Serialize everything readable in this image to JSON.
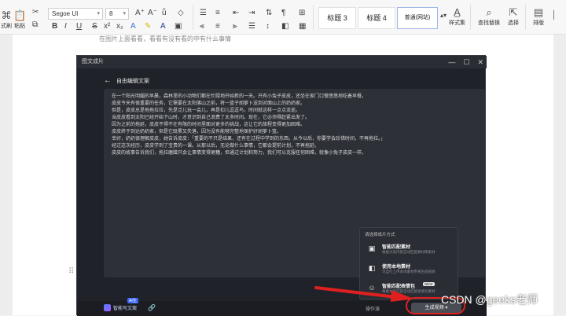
{
  "ribbon": {
    "format_label": "式刷",
    "paste_label": "粘贴",
    "font": "Segoe UI",
    "font_size": "8",
    "styles": [
      "标题 3",
      "标题 4",
      "普通(网站)"
    ],
    "style_set_label": "样式集",
    "find_replace_label": "查找替换",
    "select_label": "选择",
    "sort_label": "排版"
  },
  "document": {
    "cut_off_text": "在图片上面看看，看看有没有看的中有什么事情"
  },
  "dialog": {
    "title": "图文成片",
    "back_label": "自由编辑文案",
    "editor_lines": [
      "在一个阳光明媚的早晨，森林里的小动物们都在忙碌地开始新的一天。只有小兔子皮皮，还坐在家门口慢悠悠地吃着早餐。",
      "皮皮今天有很重要的任务，它需要在太阳落山之前，将一篮子胡萝卜送到对面山上的奶奶家。",
      "但是，皮皮总是拖拖拉拉，先是泛儿玩一会儿，再是扣儿逗逗鸟，时间就这样一点点流逝。",
      "当皮皮看到太阳已经开始下山时，才意识到自己浪费了太多时间。现在，它必须得赶紧出发了。",
      "因为之前的拖延，皮皮不得不在有限的时间里面对更多的挑战，这让它的旅程变得更加困难。",
      "皮皮终于到达奶奶家，但是它既累又失落，因为没有能够完整地保护好胡萝卜篮。",
      "幸好，奶奶很理解皮皮，她告诉皮皮：「重要的不只是结果，还有在过程中学到的东西。从今以后，你要学会珍惜时间，不再拖拉。」",
      "经过这次经历，皮皮学到了宝贵的一课。从那以后，无论做什么事情，它都会提前计划，不再拖延。",
      "皮皮的故事告诉我们，拖拉磨蹭只会让事情变得更糟，但通过计划和努力，我们可以克服任何困难，就像小兔子皮皮一样。"
    ],
    "ai_write_label": "智能写文案",
    "ai_badge": "AI生",
    "bottom_mid_label": "操作演",
    "generate_label": "生成视频",
    "popup": {
      "header": "请选择成片方式",
      "items": [
        {
          "title": "智能匹配素材",
          "desc": "根据文案内容自动匹配素材库素材",
          "icon": "image-match-icon"
        },
        {
          "title": "使用本地素材",
          "desc": "可自行上传本地素材用来生成视频",
          "icon": "local-media-icon"
        },
        {
          "title": "智能匹配表情包",
          "desc": "根据文案内容自动匹配表情包素材",
          "badge": "NEW",
          "icon": "emoji-icon"
        }
      ]
    }
  },
  "watermark": "CSDN @geeks老师",
  "colors": {
    "annotation_red": "#e02020",
    "dialog_bg": "#1f2228"
  }
}
